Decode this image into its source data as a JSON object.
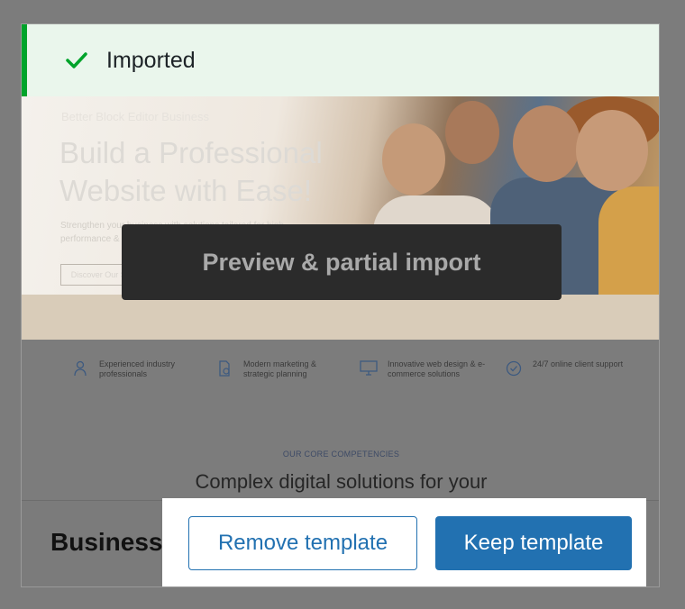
{
  "notice": {
    "status_text": "Imported",
    "icon": "check-icon",
    "accent": "#00a32a"
  },
  "hero": {
    "eyebrow": "Better Block Editor Business",
    "title_line1": "Build a Professional",
    "title_line2": "Website with Ease!",
    "description": "Strengthen your business with solutions tailored for high performance & lasting value",
    "cta_label": "Discover Our Services"
  },
  "overlay": {
    "label": "Preview & partial import"
  },
  "features": [
    {
      "icon": "person-icon",
      "text": "Experienced industry professionals"
    },
    {
      "icon": "document-chart-icon",
      "text": "Modern marketing & strategic planning"
    },
    {
      "icon": "monitor-code-icon",
      "text": "Innovative web design & e-commerce solutions"
    },
    {
      "icon": "badge-check-icon",
      "text": "24/7 online client support"
    }
  ],
  "competencies": {
    "label": "OUR CORE COMPETENCIES",
    "title": "Complex digital solutions for your"
  },
  "footer": {
    "template_name": "Business",
    "remove_label": "Remove template",
    "keep_label": "Keep template",
    "primary_color": "#2271b1"
  }
}
